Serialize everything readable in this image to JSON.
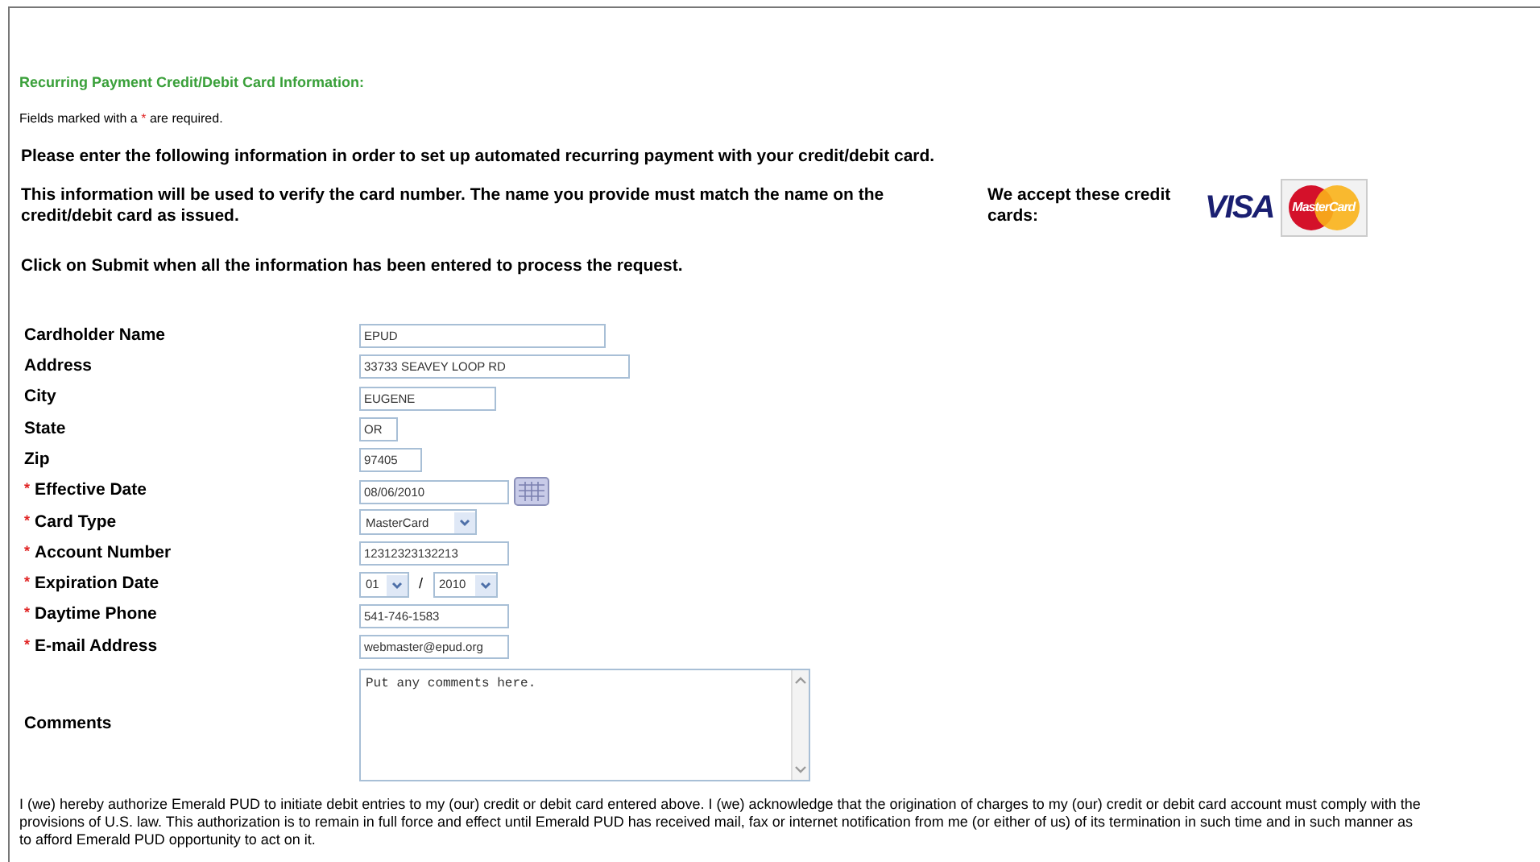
{
  "title": "Recurring Payment Credit/Debit Card Information:",
  "fields_note": {
    "before": "Fields marked with a",
    "mark": "*",
    "after": "are required."
  },
  "instructions": [
    "Please enter the following information in order to set up automated recurring payment with your credit/debit card.",
    "This information will be used to verify the card number. The name you provide must match the name on the credit/debit card as issued."
  ],
  "accepted_cards": {
    "label": "We accept these credit cards:",
    "cards": [
      "VISA",
      "MasterCard"
    ]
  },
  "submit_note": "Click on Submit when all the information has been entered to process the request.",
  "fields": [
    {
      "kind": "text",
      "label": "Cardholder Name",
      "value": "EPUD"
    },
    {
      "kind": "text",
      "label": "Address",
      "value": "33733 SEAVEY LOOP RD"
    },
    {
      "kind": "text",
      "label": "City",
      "value": "EUGENE"
    },
    {
      "kind": "text",
      "label": "State",
      "value": "OR"
    },
    {
      "kind": "text",
      "label": "Zip",
      "value": "97405"
    },
    {
      "kind": "date",
      "label": "Effective Date",
      "mark": "*",
      "value": "08/06/2010"
    },
    {
      "kind": "select",
      "label": "Card Type",
      "mark": "*",
      "value": "MasterCard"
    },
    {
      "kind": "text",
      "label": "Account Number",
      "mark": "*",
      "value": "12312323132213"
    },
    {
      "kind": "expiry",
      "label": "Expiration Date",
      "mark": "*",
      "month": "01",
      "separator": "/",
      "year": "2010"
    },
    {
      "kind": "text",
      "label": "Daytime Phone",
      "mark": "*",
      "value": "541-746-1583"
    },
    {
      "kind": "text",
      "label": "E-mail Address",
      "mark": "*",
      "value": "webmaster@epud.org"
    },
    {
      "kind": "textarea",
      "label": "Comments",
      "value": "Put any comments here."
    }
  ],
  "authorization": "I (we) hereby authorize Emerald PUD to initiate debit entries to my (our) credit or debit card entered above. I (we) acknowledge that the origination of charges to my (our) credit or debit card account must comply with the provisions of U.S. law. This authorization is to remain in full force and effect until Emerald PUD has received mail, fax or internet notification from me (or either of us) of its termination in such time and in such manner as to afford Emerald PUD opportunity to act on it."
}
